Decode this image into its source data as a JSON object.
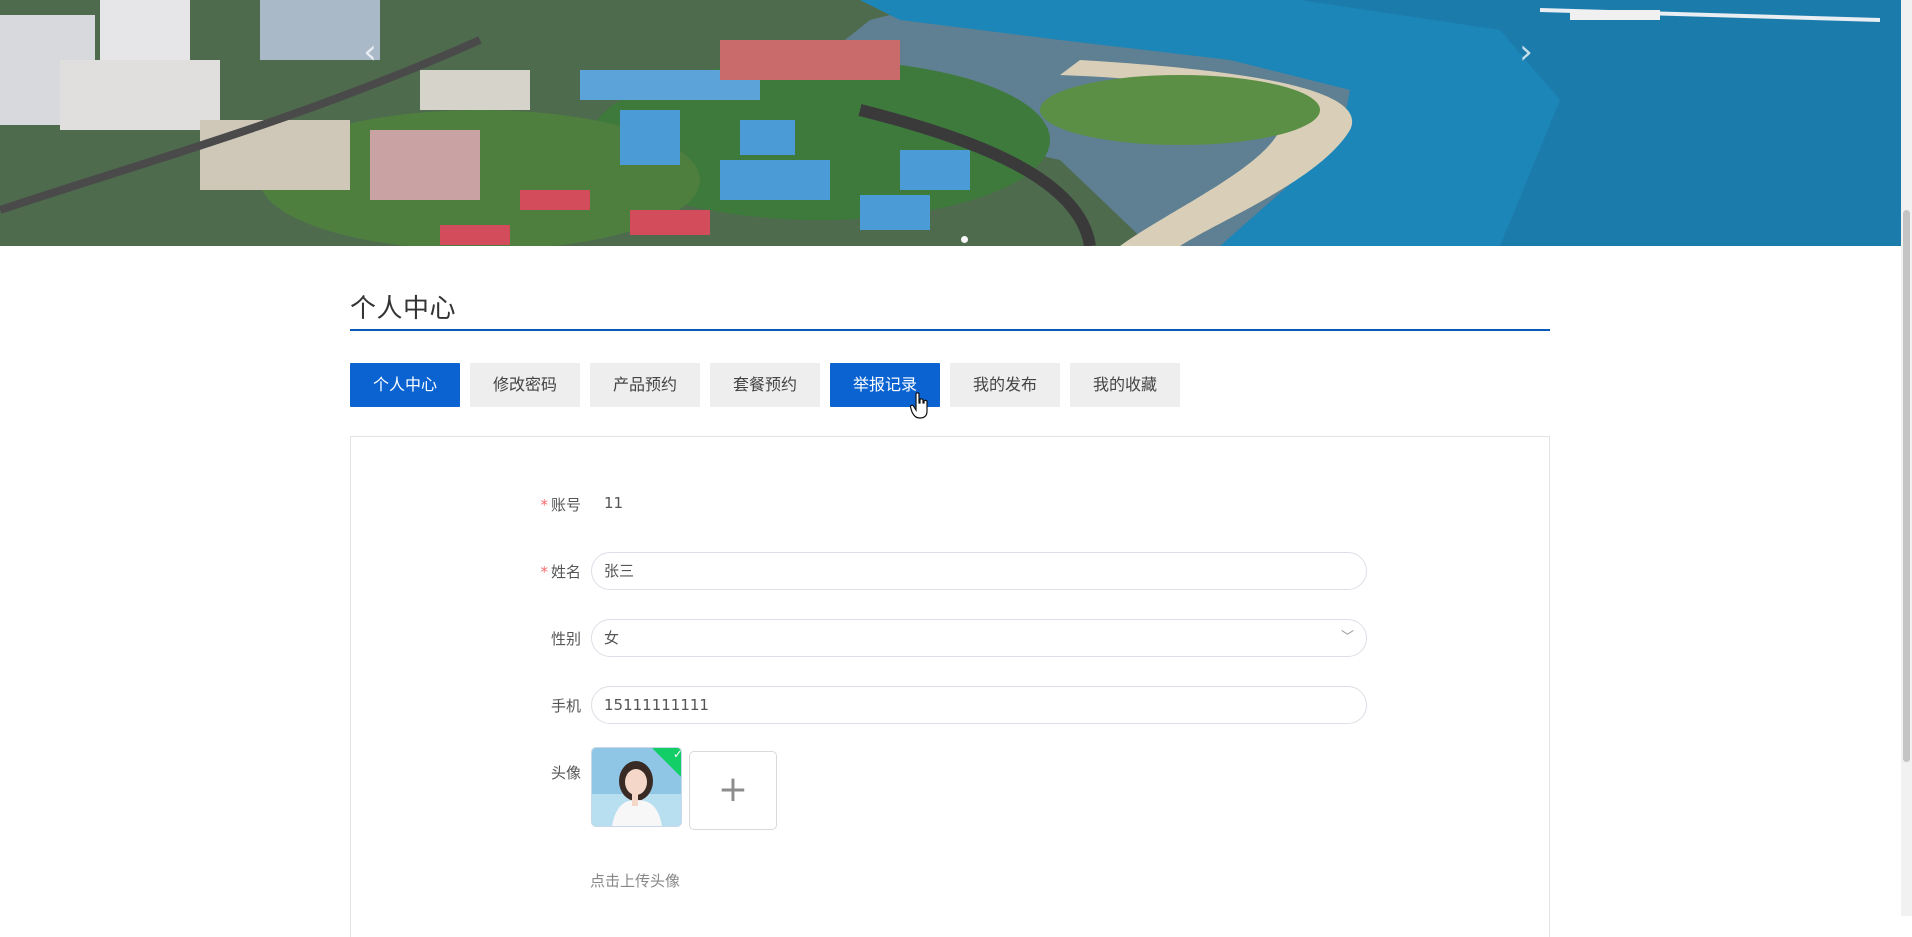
{
  "banner": {
    "prev_arrow": "‹",
    "next_arrow": "›",
    "active_slide": 1,
    "slide_count": 1
  },
  "page_title": "个人中心",
  "tabs": [
    {
      "label": "个人中心",
      "active": true
    },
    {
      "label": "修改密码",
      "active": false
    },
    {
      "label": "产品预约",
      "active": false
    },
    {
      "label": "套餐预约",
      "active": false
    },
    {
      "label": "举报记录",
      "active": true
    },
    {
      "label": "我的发布",
      "active": false
    },
    {
      "label": "我的收藏",
      "active": false
    }
  ],
  "form": {
    "account": {
      "label": "账号",
      "required": "*",
      "value": "11"
    },
    "name": {
      "label": "姓名",
      "required": "*",
      "value": "张三"
    },
    "gender": {
      "label": "性别",
      "value": "女",
      "chevron": "﹀"
    },
    "phone": {
      "label": "手机",
      "value": "15111111111"
    },
    "avatar": {
      "label": "头像",
      "check": "✓",
      "add": "+",
      "hint": "点击上传头像"
    }
  },
  "colors": {
    "accent": "#0a63d1",
    "title_underline": "#0a5bb8",
    "required": "#f56c6c",
    "upload_success": "#13ce66"
  }
}
